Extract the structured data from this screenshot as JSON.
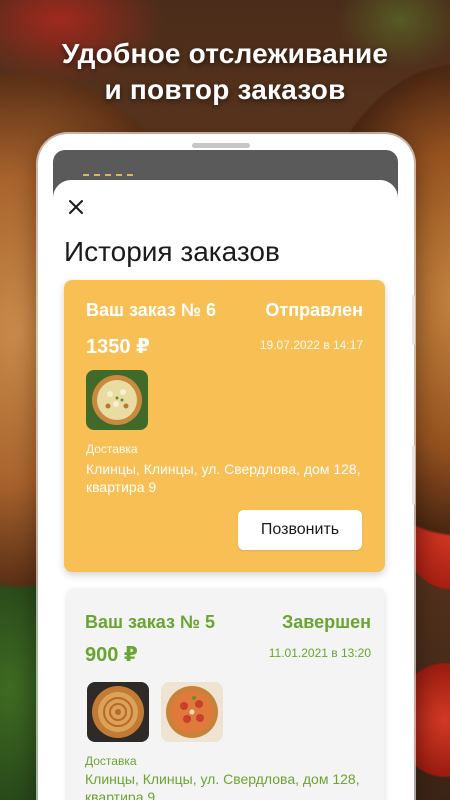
{
  "promo": {
    "headline_line1": "Удобное отслеживание",
    "headline_line2": "и повтор заказов"
  },
  "screen": {
    "title": "История заказов",
    "close_icon": "close-icon"
  },
  "orders": [
    {
      "number": "Ваш заказ № 6",
      "status": "Отправлен",
      "price": "1350 ₽",
      "datetime": "19.07.2022 в 14:17",
      "delivery_label": "Доставка",
      "address": "Клинцы, Клинцы, ул. Свердлова, дом 128, квартира 9",
      "call_label": "Позвонить",
      "accent": "#f8bf55"
    },
    {
      "number": "Ваш заказ № 5",
      "status": "Завершен",
      "price": "900 ₽",
      "datetime": "11.01.2021 в 13:20",
      "delivery_label": "Доставка",
      "address": "Клинцы, Клинцы, ул. Свердлова, дом 128, квартира 9",
      "accent": "#6aa431"
    }
  ]
}
